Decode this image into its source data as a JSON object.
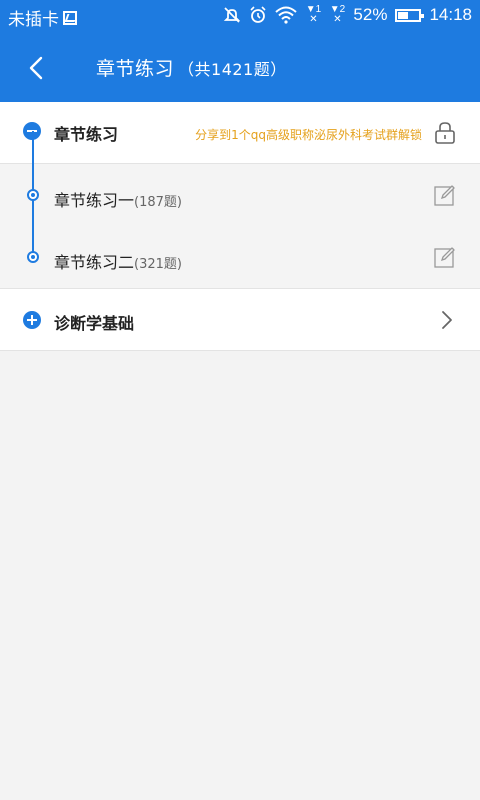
{
  "status_bar": {
    "carrier": "未插卡",
    "battery": "52%",
    "time": "14:18",
    "sim1": "1",
    "sim2": "2"
  },
  "app_bar": {
    "title": "章节练习",
    "count": "（共1421题）"
  },
  "chapters": [
    {
      "title": "章节练习",
      "hint": "分享到1个qq高级职称泌尿外科考试群解锁",
      "expanded": true,
      "items": [
        {
          "title": "章节练习一",
          "count": "(187题)"
        },
        {
          "title": "章节练习二",
          "count": "(321题)"
        }
      ]
    },
    {
      "title": "诊断学基础",
      "expanded": false
    }
  ],
  "colors": {
    "primary": "#1e7be0",
    "hint": "#e5a11c",
    "background": "#f3f3f3"
  },
  "icons": {
    "back": "chevron-left-icon",
    "lock": "lock-icon",
    "edit": "edit-icon",
    "expand": "chevron-right-icon"
  }
}
